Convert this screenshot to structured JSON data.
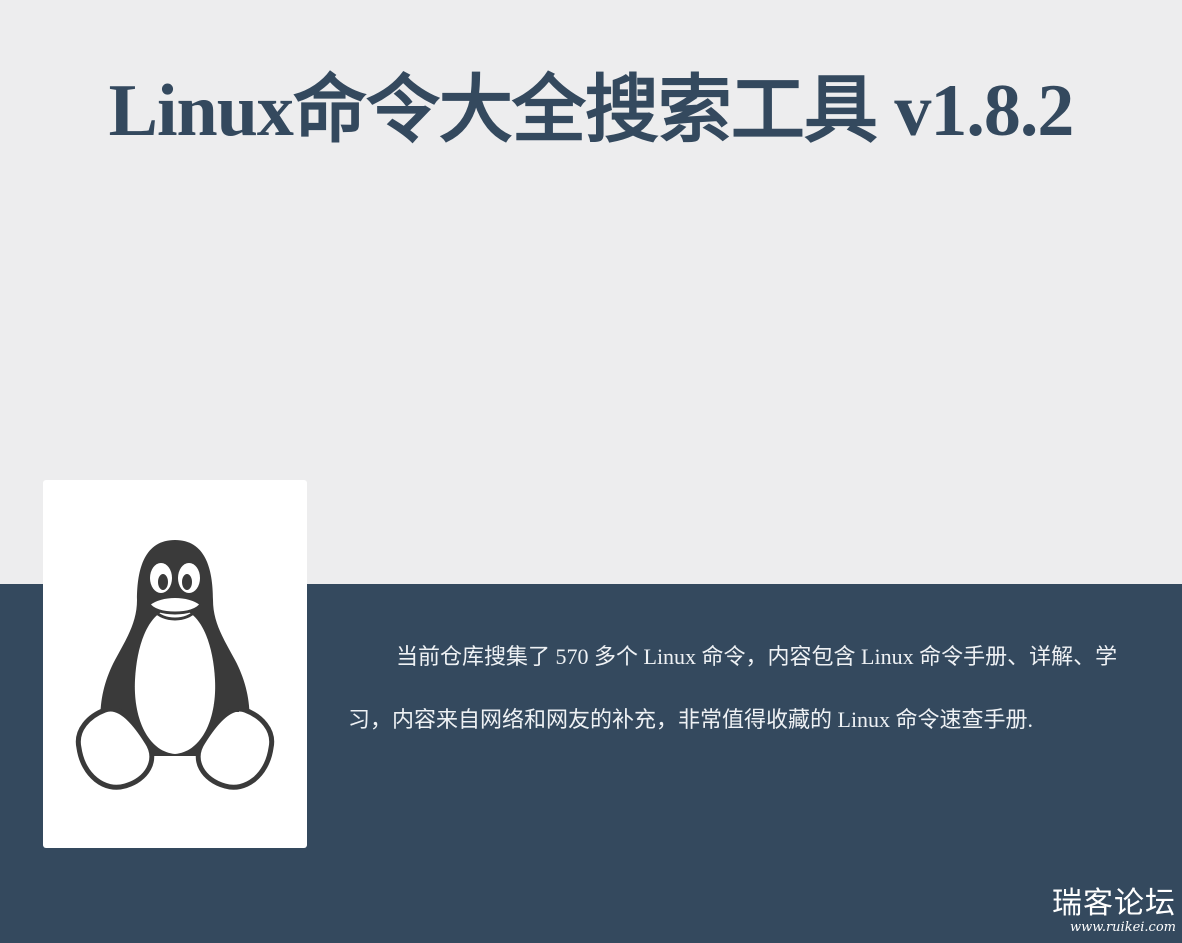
{
  "header": {
    "title": "Linux命令大全搜索工具 v1.8.2"
  },
  "logo": {
    "icon": "tux-penguin-icon"
  },
  "content": {
    "description": "当前仓库搜集了 570 多个 Linux 命令，内容包含 Linux 命令手册、详解、学习，内容来自网络和网友的补充，非常值得收藏的 Linux 命令速查手册."
  },
  "watermark": {
    "name": "瑞客论坛",
    "url": "www.ruikei.com"
  },
  "colors": {
    "background": "#ededee",
    "band": "#34495e",
    "title": "#34495e",
    "card": "#ffffff"
  }
}
